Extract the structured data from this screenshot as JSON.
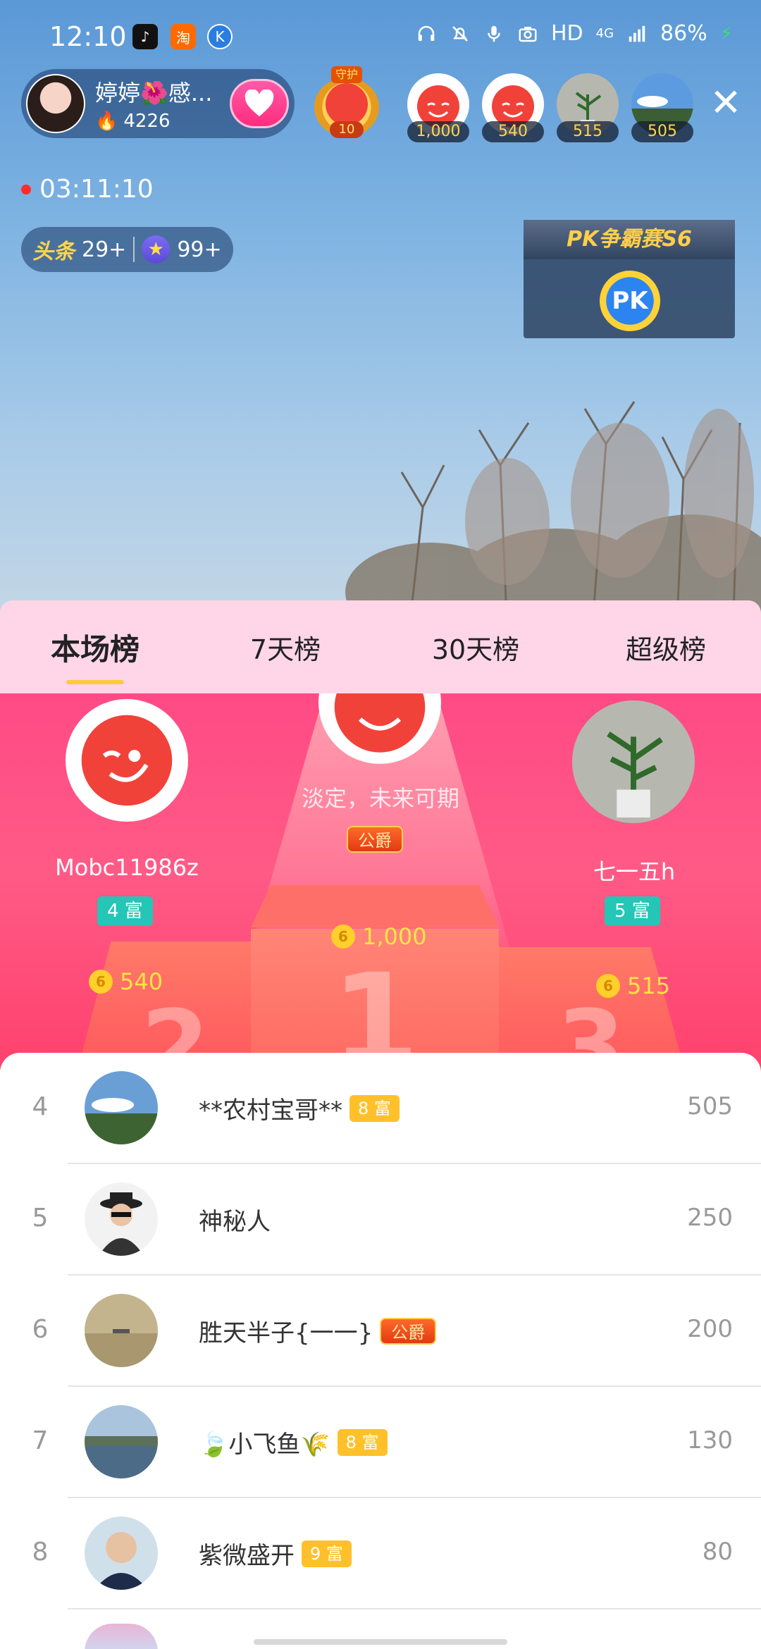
{
  "status_bar": {
    "time": "12:10",
    "apps": [
      "tiktok-icon",
      "taobao-icon",
      "k-icon"
    ],
    "hd": "HD",
    "network": "4G",
    "battery": "86%"
  },
  "host": {
    "name": "婷婷🌺感...",
    "heat": "4226"
  },
  "guard": {
    "label": "守护",
    "level": "10"
  },
  "top_viewers": [
    "1,000",
    "540",
    "515",
    "505"
  ],
  "live_timer": "03:11:10",
  "hot_pill": {
    "toutiao_label": "头条",
    "toutiao_count": "29+",
    "star_count": "99+"
  },
  "pk": {
    "title": "PK争霸赛S6",
    "button": "PK"
  },
  "tabs": [
    "本场榜",
    "7天榜",
    "30天榜",
    "超级榜"
  ],
  "podium": {
    "first": {
      "name": "淡定，未来可期",
      "badge": "公爵",
      "score": "1,000",
      "rank": "1"
    },
    "second": {
      "name": "Mobc11986z",
      "badge": "4 富",
      "score": "540",
      "rank": "2"
    },
    "third": {
      "name": "七一五h",
      "badge": "5 富",
      "score": "515",
      "rank": "3"
    }
  },
  "list": [
    {
      "rank": "4",
      "name": "**农村宝哥**",
      "badge": "8 富",
      "badge_type": "gold",
      "score": "505"
    },
    {
      "rank": "5",
      "name": "神秘人",
      "badge": "",
      "badge_type": "",
      "score": "250"
    },
    {
      "rank": "6",
      "name": "胜天半子{一一}",
      "badge": "公爵",
      "badge_type": "duke",
      "score": "200"
    },
    {
      "rank": "7",
      "name": "🍃小飞鱼🌾",
      "badge": "8 富",
      "badge_type": "gold",
      "score": "130"
    },
    {
      "rank": "8",
      "name": "紫微盛开",
      "badge": "9 富",
      "badge_type": "gold",
      "score": "80"
    }
  ],
  "coin_glyph": "6"
}
